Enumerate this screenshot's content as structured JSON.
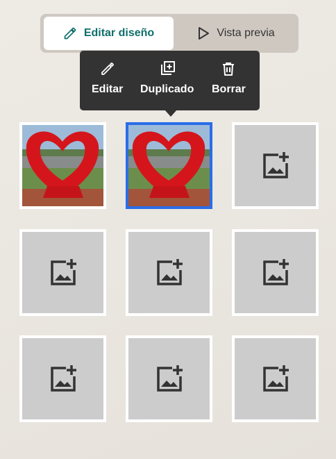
{
  "mode_toggle": {
    "edit_label": "Editar diseño",
    "preview_label": "Vista previa"
  },
  "photo_actions": {
    "edit_label": "Editar",
    "duplicate_label": "Duplicado",
    "delete_label": "Borrar"
  },
  "grid": {
    "cells": [
      {
        "type": "photo",
        "selected": false
      },
      {
        "type": "photo",
        "selected": true
      },
      {
        "type": "empty",
        "icon": "add-photo-icon"
      },
      {
        "type": "empty",
        "icon": "add-photo-icon"
      },
      {
        "type": "empty",
        "icon": "add-photo-icon"
      },
      {
        "type": "empty",
        "icon": "add-photo-icon"
      },
      {
        "type": "empty",
        "icon": "add-photo-icon"
      },
      {
        "type": "empty",
        "icon": "add-photo-icon"
      },
      {
        "type": "empty",
        "icon": "add-photo-icon"
      }
    ]
  },
  "colors": {
    "accent": "#0f6e6b",
    "selection": "#2a6de8",
    "tooltip_bg": "#333333",
    "placeholder_bg": "#cccccc"
  }
}
